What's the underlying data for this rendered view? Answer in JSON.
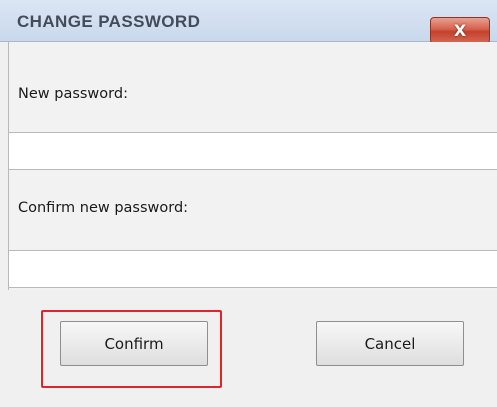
{
  "window": {
    "title": "CHANGE PASSWORD",
    "close_glyph": "X",
    "close_icon": "close-icon"
  },
  "form": {
    "new_password_label": "New password:",
    "new_password_value": "",
    "confirm_password_label": "Confirm new password:",
    "confirm_password_value": ""
  },
  "buttons": {
    "confirm_label": "Confirm",
    "cancel_label": "Cancel"
  },
  "colors": {
    "highlight": "#e0242c",
    "close_button": "#c4412c"
  }
}
